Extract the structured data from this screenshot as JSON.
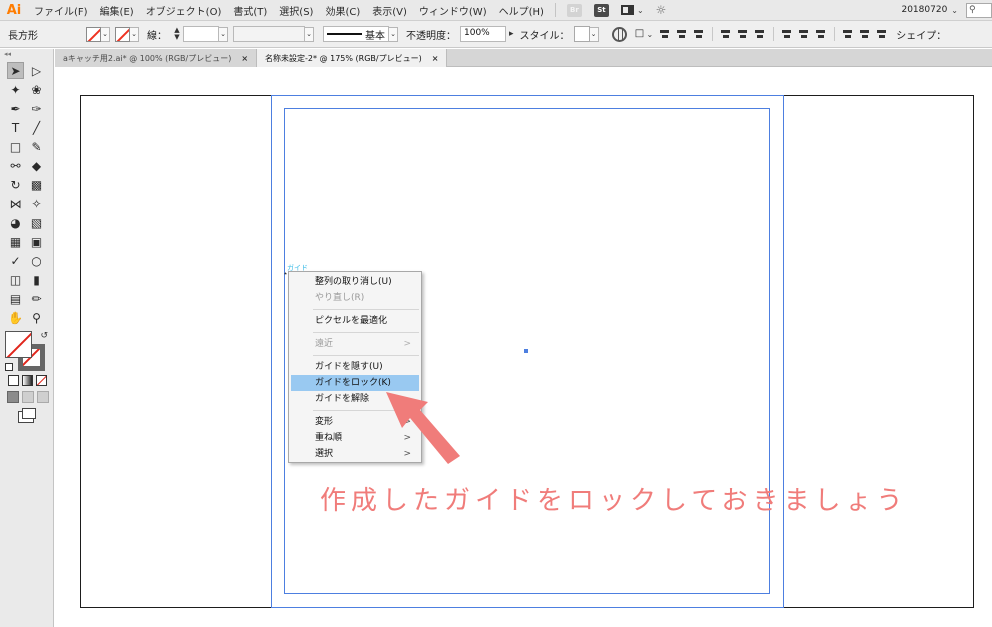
{
  "app": {
    "logo": "Ai"
  },
  "menubar": {
    "items": [
      "ファイル(F)",
      "編集(E)",
      "オブジェクト(O)",
      "書式(T)",
      "選択(S)",
      "効果(C)",
      "表示(V)",
      "ウィンドウ(W)",
      "ヘルプ(H)"
    ],
    "bridge_badge": "Br",
    "stock_badge": "St",
    "workspace": "20180720",
    "search_icon": "⚲"
  },
  "controlbar": {
    "tool_name": "長方形",
    "stroke_label": "線：",
    "stroke_weight": "",
    "stroke_profile": "基本",
    "opacity_label": "不透明度：",
    "opacity_value": "100%",
    "style_label": "スタイル：",
    "shape_label": "シェイプ："
  },
  "tabs": [
    {
      "label": "aキャッチ用2.ai* @ 100% (RGB/プレビュー)",
      "active": false
    },
    {
      "label": "名称未設定-2* @ 175% (RGB/プレビュー)",
      "active": true
    }
  ],
  "tab_close_glyph": "×",
  "canvas": {
    "guide_label": "ガイド"
  },
  "context_menu": {
    "items": [
      {
        "label": "整列の取り消し(U)",
        "disabled": false
      },
      {
        "label": "やり直し(R)",
        "disabled": true
      },
      {
        "label": "ピクセルを最適化",
        "disabled": false
      },
      {
        "label": "遠近",
        "disabled": true,
        "submenu": true
      },
      {
        "label": "ガイドを隠す(U)",
        "disabled": false
      },
      {
        "label": "ガイドをロック(K)",
        "disabled": false,
        "highlighted": true
      },
      {
        "label": "ガイドを解除",
        "disabled": false
      },
      {
        "label": "変形",
        "disabled": false,
        "submenu": true
      },
      {
        "label": "重ね順",
        "disabled": false,
        "submenu": true
      },
      {
        "label": "選択",
        "disabled": false,
        "submenu": true
      }
    ],
    "submenu_glyph": ">"
  },
  "annotation": {
    "text": "作成したガイドをロックしておきましょう",
    "color": "#f07c7a"
  },
  "colors": {
    "guide": "#4d7fe0",
    "highlight": "#99c9f1",
    "annotation": "#f07c7a"
  }
}
